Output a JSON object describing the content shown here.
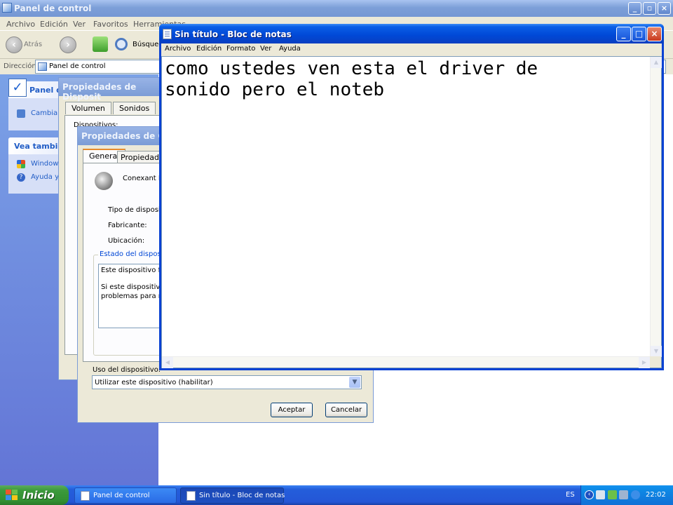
{
  "control_panel": {
    "title": "Panel de control",
    "menu": [
      "Archivo",
      "Edición",
      "Ver",
      "Favoritos",
      "Herramientas"
    ],
    "toolbar": {
      "back_label": "Atrás",
      "search_label": "Búsqueda"
    },
    "address": {
      "label": "Dirección",
      "value": "Panel de control"
    },
    "sidebar": {
      "panel_title": "Panel de control",
      "switch_link": "Cambiar",
      "see_also_title": "Vea también",
      "links": [
        "Windows",
        "Ayuda y"
      ]
    }
  },
  "dialog_back": {
    "title": "Propiedades de Disposit",
    "tabs": [
      "Volumen",
      "Sonidos"
    ],
    "partial_label": "Dispositivos:"
  },
  "dialog_front": {
    "title": "Propiedades de Con",
    "tabs": [
      "General",
      "Propiedades"
    ],
    "device_name": "Conexant H",
    "fields": [
      "Tipo de dispositivo",
      "Fabricante:",
      "Ubicación:"
    ],
    "status_group": "Estado del dispositivo",
    "status_line1": "Este dispositivo fu",
    "status_line2": "Si este dispositivo",
    "status_line3": "problemas para res",
    "usage_label": "Uso del dispositivo:",
    "usage_value": "Utilizar este dispositivo (habilitar)",
    "ok_label": "Aceptar",
    "cancel_label": "Cancelar"
  },
  "notepad": {
    "title": "Sin título - Bloc de notas",
    "menu": [
      "Archivo",
      "Edición",
      "Formato",
      "Ver",
      "Ayuda"
    ],
    "content": "como ustedes ven esta el driver de\nsonido pero el noteb"
  },
  "taskbar": {
    "start_label": "Inicio",
    "tasks": [
      "Panel de control",
      "Sin título - Bloc de notas"
    ],
    "language": "ES",
    "clock": "22:02"
  }
}
